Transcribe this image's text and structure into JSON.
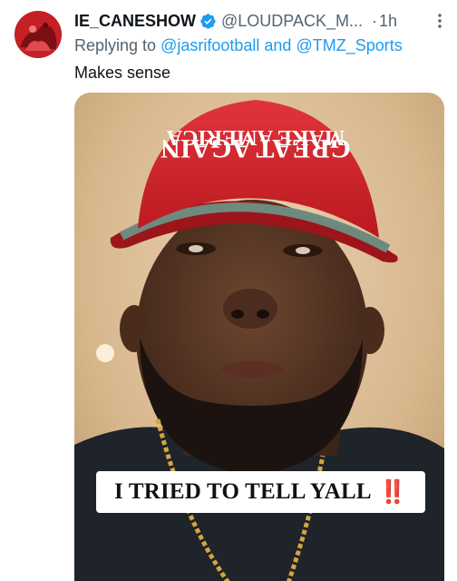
{
  "tweet": {
    "display_name": "IE_CANESHOW",
    "handle": "@LOUDPACK_M...",
    "separator": "·",
    "timestamp": "1h",
    "reply": {
      "prefix": "Replying to ",
      "mention1": "@jasrifootball",
      "conjunction": " and ",
      "mention2": "@TMZ_Sports"
    },
    "text": "Makes sense"
  },
  "media": {
    "hat_text_line1": "MAKE AMERICA",
    "hat_text_line2": "GREAT AGAIN",
    "caption": "I TRIED TO TELL YALL",
    "caption_emoji": "‼️"
  },
  "icons": {
    "verified": "verified-badge-icon",
    "more": "more-options-icon"
  },
  "colors": {
    "link": "#1d9bf0",
    "secondary_text": "#536471",
    "primary_text": "#0f1419",
    "verified_badge": "#1d9bf0",
    "hat_red": "#d3272c"
  }
}
